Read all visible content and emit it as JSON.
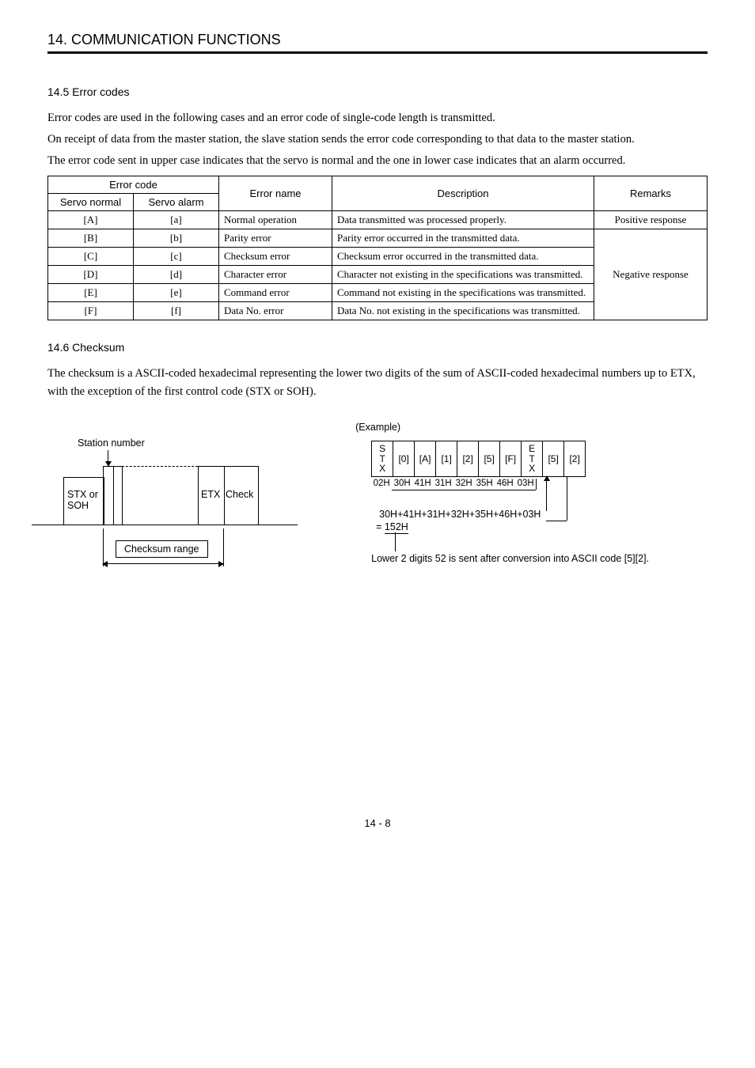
{
  "chapter": "14. COMMUNICATION FUNCTIONS",
  "sections": {
    "s1": {
      "num": "14.5",
      "title": "Error codes"
    },
    "s2": {
      "num": "14.6",
      "title": "Checksum"
    }
  },
  "paras": {
    "p1": "Error codes are used in the following cases and an error code of single-code length is transmitted.",
    "p2": "On receipt of data from the master station, the slave station sends the error code corresponding to that data to the master station.",
    "p3": "The error code sent in upper case indicates that the servo is normal and the one in lower case indicates that an alarm occurred.",
    "p4": "The checksum is a ASCII-coded hexadecimal representing the lower two digits of the sum of ASCII-coded hexadecimal numbers up to ETX, with the exception of the first control code (STX or SOH)."
  },
  "table": {
    "head": {
      "errcode": "Error code",
      "servo_normal": "Servo normal",
      "servo_alarm": "Servo alarm",
      "errname": "Error name",
      "desc": "Description",
      "remarks": "Remarks"
    },
    "rows": [
      {
        "sn": "[A]",
        "sa": "[a]",
        "name": "Normal operation",
        "desc": "Data transmitted was processed properly."
      },
      {
        "sn": "[B]",
        "sa": "[b]",
        "name": "Parity error",
        "desc": "Parity error occurred in the transmitted data."
      },
      {
        "sn": "[C]",
        "sa": "[c]",
        "name": "Checksum error",
        "desc": "Checksum error occurred in the transmitted data."
      },
      {
        "sn": "[D]",
        "sa": "[d]",
        "name": "Character error",
        "desc": "Character not existing in the specifications was transmitted."
      },
      {
        "sn": "[E]",
        "sa": "[e]",
        "name": "Command error",
        "desc": "Command not existing in the specifications was transmitted."
      },
      {
        "sn": "[F]",
        "sa": "[f]",
        "name": "Data No. error",
        "desc": "Data No. not existing in the specifications was transmitted."
      }
    ],
    "remarks": {
      "pos": "Positive response",
      "neg": "Negative response"
    }
  },
  "diagram_left": {
    "station_number": "Station number",
    "stx_soh_line1": "STX or",
    "stx_soh_line2": "SOH",
    "etx": "ETX",
    "check": "Check",
    "checksum_range": "Checksum range"
  },
  "diagram_right": {
    "example": "(Example)",
    "bytes": [
      "STX",
      "[0]",
      "[A]",
      "[1]",
      "[2]",
      "[5]",
      "[F]",
      "ETX",
      "[5]",
      "[2]"
    ],
    "hex": [
      "02H",
      "30H",
      "41H",
      "31H",
      "32H",
      "35H",
      "46H",
      "03H"
    ],
    "sum_line": "30H+41H+31H+32H+35H+46H+03H",
    "result_line": "=152H",
    "note": "Lower 2 digits 52 is sent after conversion into ASCII code [5][2]."
  },
  "footer": "14 -  8"
}
